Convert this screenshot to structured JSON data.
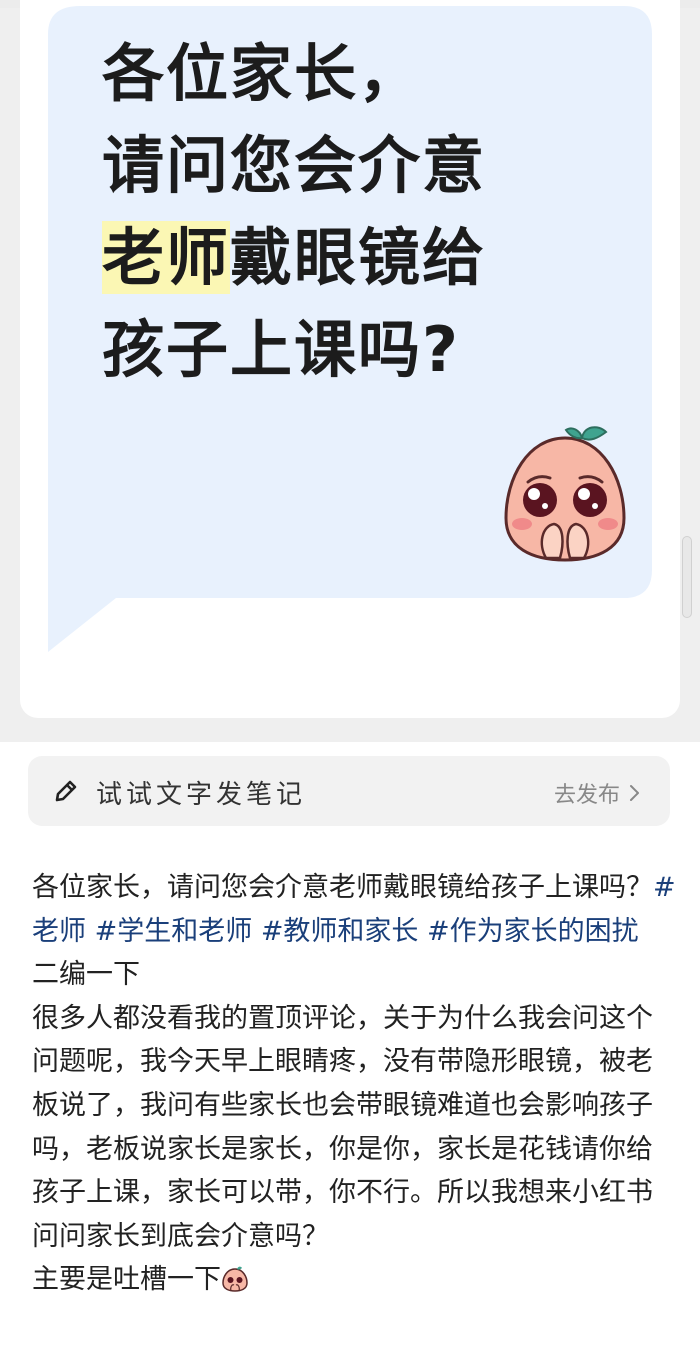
{
  "image_card": {
    "headline": {
      "line1": "各位家长，",
      "line2": "请问您会介意",
      "line3_highlight": "老师",
      "line3_rest": "戴眼镜给",
      "line4": "孩子上课吗?"
    },
    "emoji_icon": "pleading-peach-emoji-icon"
  },
  "write_bar": {
    "label": "试试文字发笔记",
    "publish_label": "去发布",
    "icons": [
      "pencil-icon",
      "chevron-right-icon"
    ]
  },
  "post": {
    "intro": "各位家长，请问您会介意老师戴眼镜给孩子上课吗？",
    "tags": [
      "#老师",
      "#学生和老师",
      "#教师和家长",
      "#作为家长的困扰"
    ],
    "edit_note": "二编一下",
    "body": "很多人都没看我的置顶评论，关于为什么我会问这个问题呢，我今天早上眼睛疼，没有带隐形眼镜，被老板说了，我问有些家长也会带眼镜难道也会影响孩子吗，老板说家长是家长，你是你，家长是花钱请你给孩子上课，家长可以带，你不行。所以我想来小红书问问家长到底会介意吗？",
    "closing": "主要是吐槽一下",
    "closing_icon": "peach-emoji-icon"
  },
  "colors": {
    "bubble": "#e8f1fd",
    "highlight": "#fbf7b4",
    "tag": "#1a3f7a",
    "leaf": "#3fa38f"
  }
}
